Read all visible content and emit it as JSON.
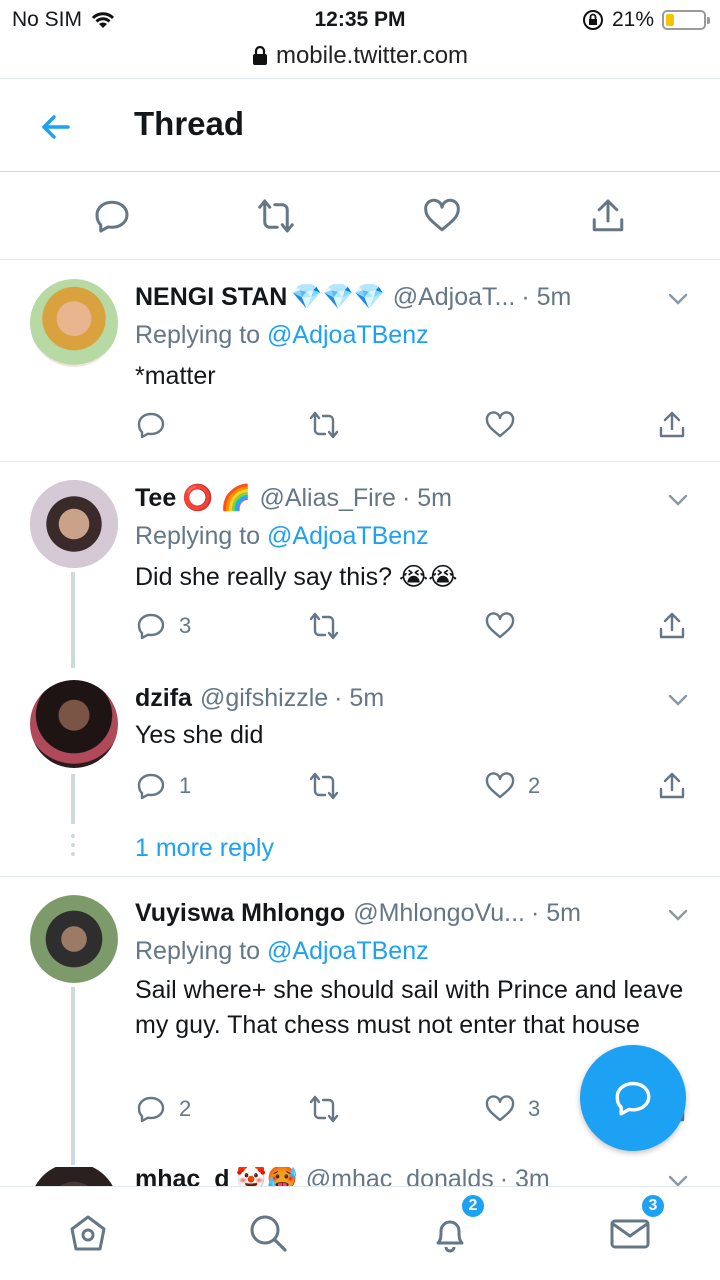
{
  "status_bar": {
    "carrier": "No SIM",
    "time": "12:35 PM",
    "battery": "21%",
    "battery_level": 0.21
  },
  "browser": {
    "url": "mobile.twitter.com"
  },
  "header": {
    "title": "Thread"
  },
  "tweets": [
    {
      "name": "NENGI STAN",
      "name_emoji": "💎💎💎",
      "handle": "@AdjoaT...",
      "time": "· 5m",
      "replying_prefix": "Replying to ",
      "replying_to": "@AdjoaTBenz",
      "text": "*matter",
      "reply_count": "",
      "like_count": ""
    },
    {
      "name": "Tee",
      "name_emoji": "⭕ 🌈",
      "handle": "@Alias_Fire",
      "time": "· 5m",
      "replying_prefix": "Replying to ",
      "replying_to": "@AdjoaTBenz",
      "text": "Did she really say this? 😭😭",
      "reply_count": "3",
      "like_count": ""
    },
    {
      "name": "dzifa",
      "handle": "@gifshizzle",
      "time": "· 5m",
      "text": "Yes she did",
      "reply_count": "1",
      "like_count": "2"
    },
    {
      "name": "Vuyiswa Mhlongo",
      "handle": "@MhlongoVu...",
      "time": "· 5m",
      "replying_prefix": "Replying to ",
      "replying_to": "@AdjoaTBenz",
      "text": "Sail where+ she should sail with Prince and leave my guy. That chess must not enter that house",
      "reply_count": "2",
      "like_count": "3"
    },
    {
      "name": "mhac_d",
      "name_emoji": "🤡🥵",
      "handle": "@mhac_donalds",
      "time": "· 3m"
    }
  ],
  "more_replies": "1 more reply",
  "nav": {
    "notifications_badge": "2",
    "messages_badge": "3"
  },
  "colors": {
    "accent": "#1da1f2",
    "muted": "#657786",
    "text": "#14171a"
  }
}
